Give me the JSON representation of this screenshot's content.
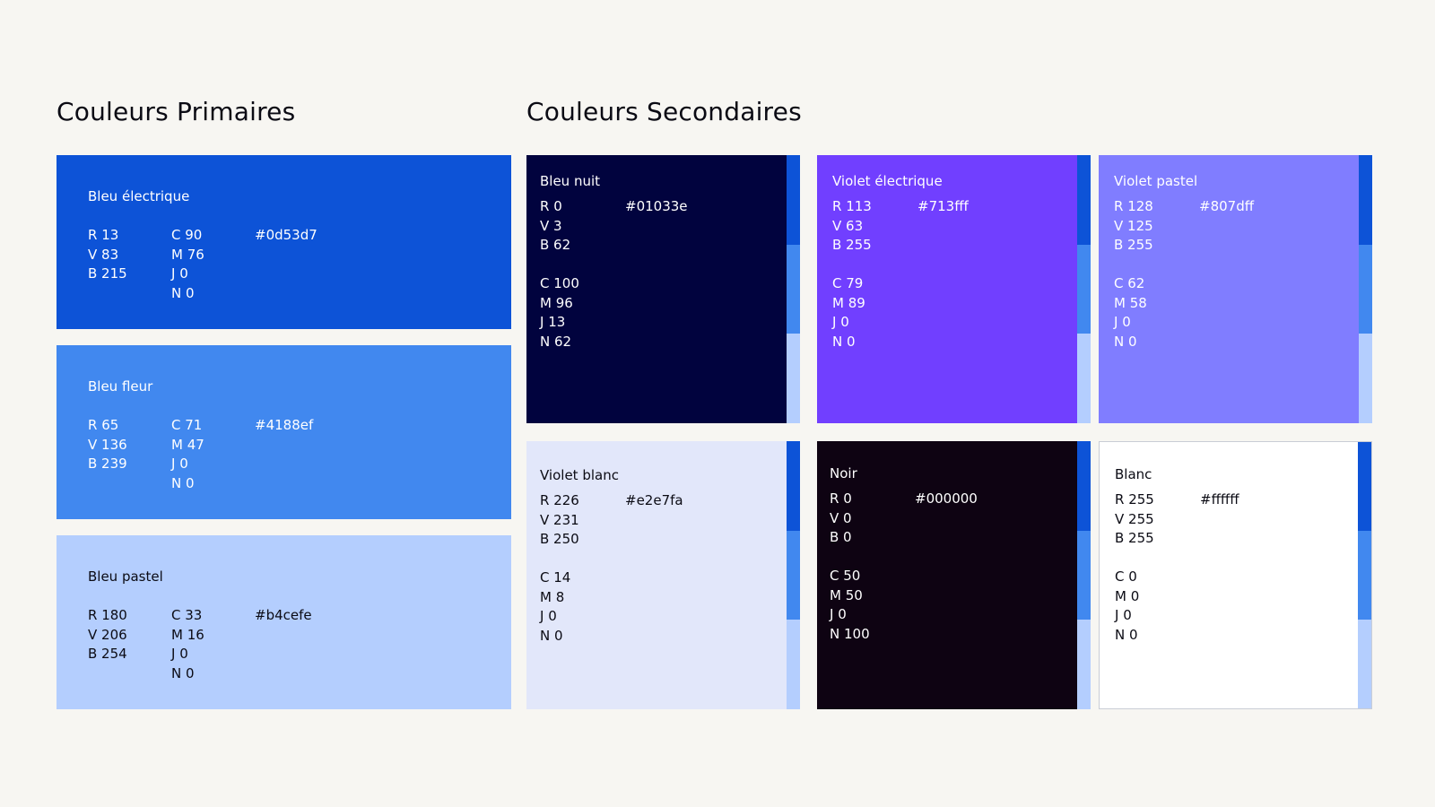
{
  "headings": {
    "primary": "Couleurs Primaires",
    "secondary": "Couleurs Secondaires"
  },
  "strip_colors": [
    "#0d53d7",
    "#4188ef",
    "#b4cefe"
  ],
  "primary": [
    {
      "name": "Bleu électrique",
      "hex": "#0d53d7",
      "text_color": "#ffffff",
      "rgb": [
        "R 13",
        "V 83",
        "B 215"
      ],
      "cmjn": [
        "C 90",
        "M 76",
        "J 0",
        "N 0"
      ]
    },
    {
      "name": "Bleu fleur",
      "hex": "#4188ef",
      "text_color": "#ffffff",
      "rgb": [
        "R 65",
        "V 136",
        "B 239"
      ],
      "cmjn": [
        "C 71",
        "M 47",
        "J 0",
        "N 0"
      ]
    },
    {
      "name": "Bleu pastel",
      "hex": "#b4cefe",
      "text_color": "#0b0b14",
      "rgb": [
        "R 180",
        "V 206",
        "B 254"
      ],
      "cmjn": [
        "C 33",
        "M 16",
        "J 0",
        "N 0"
      ]
    }
  ],
  "secondary": [
    {
      "name": "Bleu nuit",
      "hex": "#01033e",
      "text_color": "#ffffff",
      "rgb": [
        "R 0",
        "V 3",
        "B 62"
      ],
      "cmjn": [
        "C 100",
        "M 96",
        "J 13",
        "N 62"
      ]
    },
    {
      "name": "Violet électrique",
      "hex": "#713fff",
      "text_color": "#ffffff",
      "rgb": [
        "R 113",
        "V 63",
        "B 255"
      ],
      "cmjn": [
        "C 79",
        "M 89",
        "J 0",
        "N 0"
      ]
    },
    {
      "name": "Violet pastel",
      "hex": "#807dff",
      "text_color": "#ffffff",
      "rgb": [
        "R 128",
        "V 125",
        "B 255"
      ],
      "cmjn": [
        "C 62",
        "M 58",
        "J 0",
        "N 0"
      ]
    },
    {
      "name": "Violet blanc",
      "hex": "#e2e7fa",
      "text_color": "#0b0b14",
      "rgb": [
        "R 226",
        "V 231",
        "B 250"
      ],
      "cmjn": [
        "C 14",
        "M 8",
        "J 0",
        "N 0"
      ]
    },
    {
      "name": "Noir",
      "hex": "#000000",
      "text_color": "#ffffff",
      "rgb": [
        "R 0",
        "V 0",
        "B 0"
      ],
      "cmjn": [
        "C 50",
        "M 50",
        "J 0",
        "N 100"
      ]
    },
    {
      "name": "Blanc",
      "hex": "#ffffff",
      "text_color": "#0b0b14",
      "rgb": [
        "R 255",
        "V 255",
        "B 255"
      ],
      "cmjn": [
        "C 0",
        "M 0",
        "J 0",
        "N 0"
      ]
    }
  ]
}
